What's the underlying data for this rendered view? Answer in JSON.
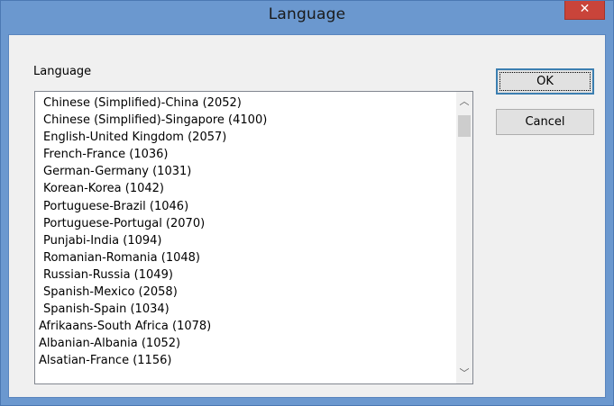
{
  "window": {
    "title": "Language",
    "close_glyph": "✕"
  },
  "group_label": "Language",
  "list": {
    "items": [
      {
        "label": "Chinese (Simplified)-China (2052)",
        "style": "indent"
      },
      {
        "label": "Chinese (Simplified)-Singapore (4100)",
        "style": "indent"
      },
      {
        "label": "English-United Kingdom (2057)",
        "style": "indent"
      },
      {
        "label": "French-France (1036)",
        "style": "indent"
      },
      {
        "label": "German-Germany (1031)",
        "style": "indent"
      },
      {
        "label": "Korean-Korea (1042)",
        "style": "indent"
      },
      {
        "label": "Portuguese-Brazil (1046)",
        "style": "indent"
      },
      {
        "label": "Portuguese-Portugal (2070)",
        "style": "indent"
      },
      {
        "label": "Punjabi-India (1094)",
        "style": "indent"
      },
      {
        "label": "Romanian-Romania (1048)",
        "style": "indent"
      },
      {
        "label": "Russian-Russia (1049)",
        "style": "indent"
      },
      {
        "label": "Spanish-Mexico (2058)",
        "style": "indent"
      },
      {
        "label": "Spanish-Spain (1034)",
        "style": "indent"
      },
      {
        "label": "Afrikaans-South Africa (1078)",
        "style": "noindent"
      },
      {
        "label": "Albanian-Albania (1052)",
        "style": "noindent"
      },
      {
        "label": "Alsatian-France (1156)",
        "style": "noindent"
      }
    ],
    "scroll_up_glyph": "︿",
    "scroll_down_glyph": "﹀"
  },
  "buttons": {
    "ok_label": "OK",
    "cancel_label": "Cancel"
  },
  "colors": {
    "titlebar": "#6b98cf",
    "close_button": "#c9443a",
    "dialog_background": "#f0f0f0",
    "default_button_border": "#3c7fb1"
  },
  "icons": {
    "close": "close-icon",
    "scroll_up": "chevron-up-icon",
    "scroll_down": "chevron-down-icon"
  }
}
